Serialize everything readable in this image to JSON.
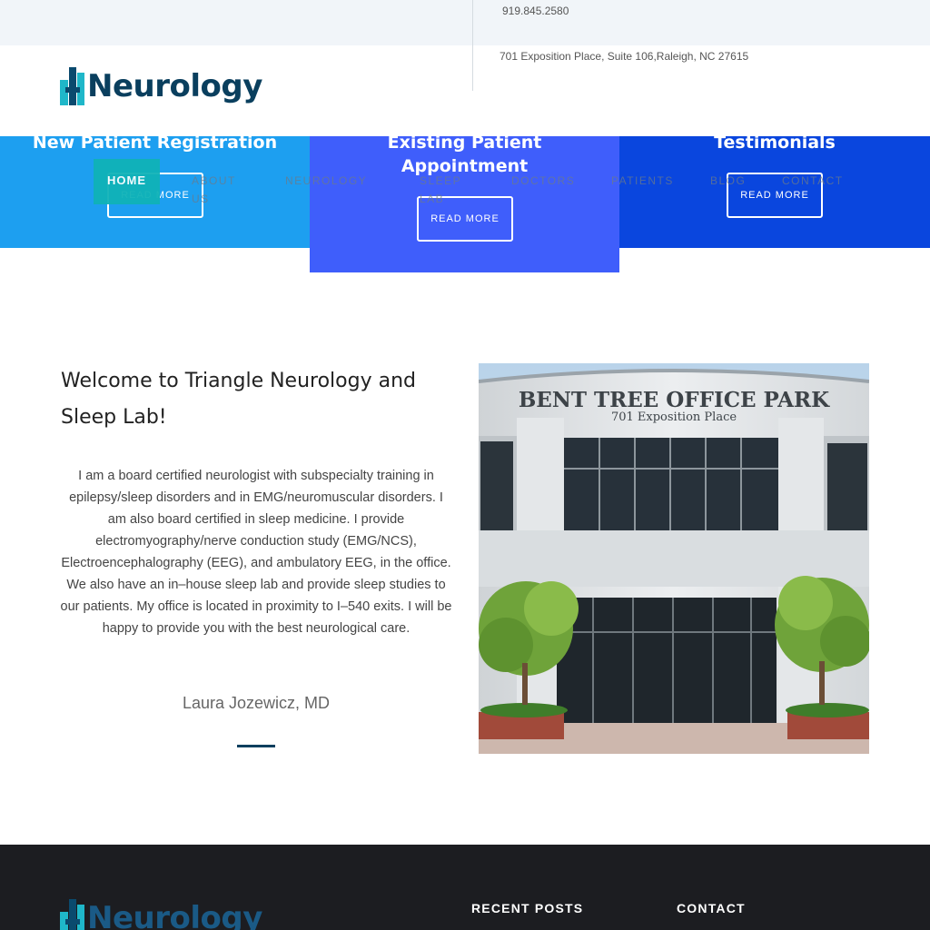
{
  "topbar": {
    "phone": "919.845.2580",
    "address": "701 Exposition Place, Suite 106,Raleigh, NC 27615"
  },
  "brand": {
    "logo_text": "Neurology",
    "colors": {
      "teal": "#1fb7c9",
      "navy": "#0a3f5e"
    }
  },
  "nav": {
    "items": [
      "HOME",
      "ABOUT US",
      "NEUROLOGY",
      "SLEEP LAB",
      "DOCTORS",
      "PATIENTS",
      "BLOG",
      "CONTACT"
    ],
    "active": "HOME"
  },
  "features": [
    {
      "title": "New Patient Registration",
      "button": "READ MORE",
      "color": "#1d9ff0"
    },
    {
      "title": "Existing Patient Appointment",
      "button": "READ MORE",
      "color": "#3f5efb"
    },
    {
      "title": "Testimonials",
      "button": "READ MORE",
      "color": "#0a46de"
    }
  ],
  "welcome": {
    "title": "Welcome to Triangle Neurology and Sleep Lab!",
    "body": "I am a board certified neurologist with subspecialty training in epilepsy/sleep disorders and in EMG/neuromuscular disorders. I am also board certified in sleep medicine. I provide electromyography/nerve conduction study (EMG/NCS), Electroencephalography (EEG), and ambulatory EEG, in the office. We also have an in–house sleep lab and provide sleep studies to our patients. My office is located in proximity to I–540 exits. I will be happy to provide you with the best neurological care.",
    "signature": "Laura Jozewicz, MD"
  },
  "photo": {
    "sign_line1": "BENT TREE OFFICE PARK",
    "sign_line2": "701 Exposition Place"
  },
  "footer": {
    "logo_text": "Neurology",
    "recent_posts": "RECENT POSTS",
    "contact": "CONTACT"
  }
}
